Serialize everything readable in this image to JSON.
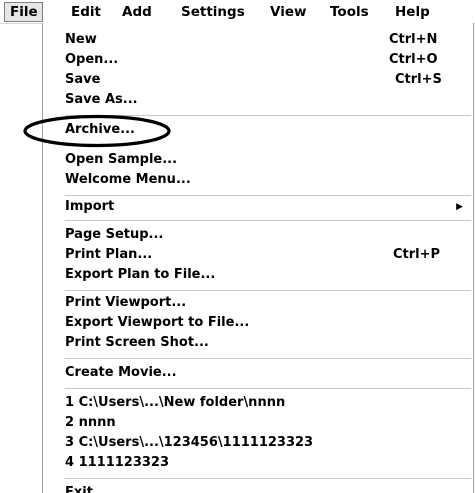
{
  "menubar": {
    "items": [
      "File",
      "Edit",
      "Add",
      "Settings",
      "View",
      "Tools",
      "Help"
    ]
  },
  "file_menu": {
    "new": {
      "label": "New",
      "shortcut": "Ctrl+N"
    },
    "open": {
      "label": "Open...",
      "shortcut": "Ctrl+O"
    },
    "save": {
      "label": "Save",
      "shortcut": "Ctrl+S"
    },
    "save_as": {
      "label": "Save As..."
    },
    "archive": {
      "label": "Archive..."
    },
    "open_sample": {
      "label": "Open Sample..."
    },
    "welcome_menu": {
      "label": "Welcome Menu..."
    },
    "import": {
      "label": "Import",
      "arrow": "▶"
    },
    "page_setup": {
      "label": "Page Setup..."
    },
    "print_plan": {
      "label": "Print Plan...",
      "shortcut": "Ctrl+P"
    },
    "export_plan": {
      "label": "Export Plan to File..."
    },
    "print_viewport": {
      "label": "Print Viewport..."
    },
    "export_viewport": {
      "label": "Export Viewport to File..."
    },
    "print_screenshot": {
      "label": "Print Screen Shot..."
    },
    "create_movie": {
      "label": "Create Movie..."
    },
    "recent": [
      "1 C:\\Users\\...\\New folder\\nnnn",
      "2 nnnn",
      "3 C:\\Users\\...\\123456\\1111123323",
      "4 1111123323"
    ],
    "exit": {
      "label": "Exit"
    }
  },
  "colors": {
    "annotation": "#000000",
    "separator": "#c8c8c8",
    "active_menu_bg": "#e6e6e6"
  }
}
